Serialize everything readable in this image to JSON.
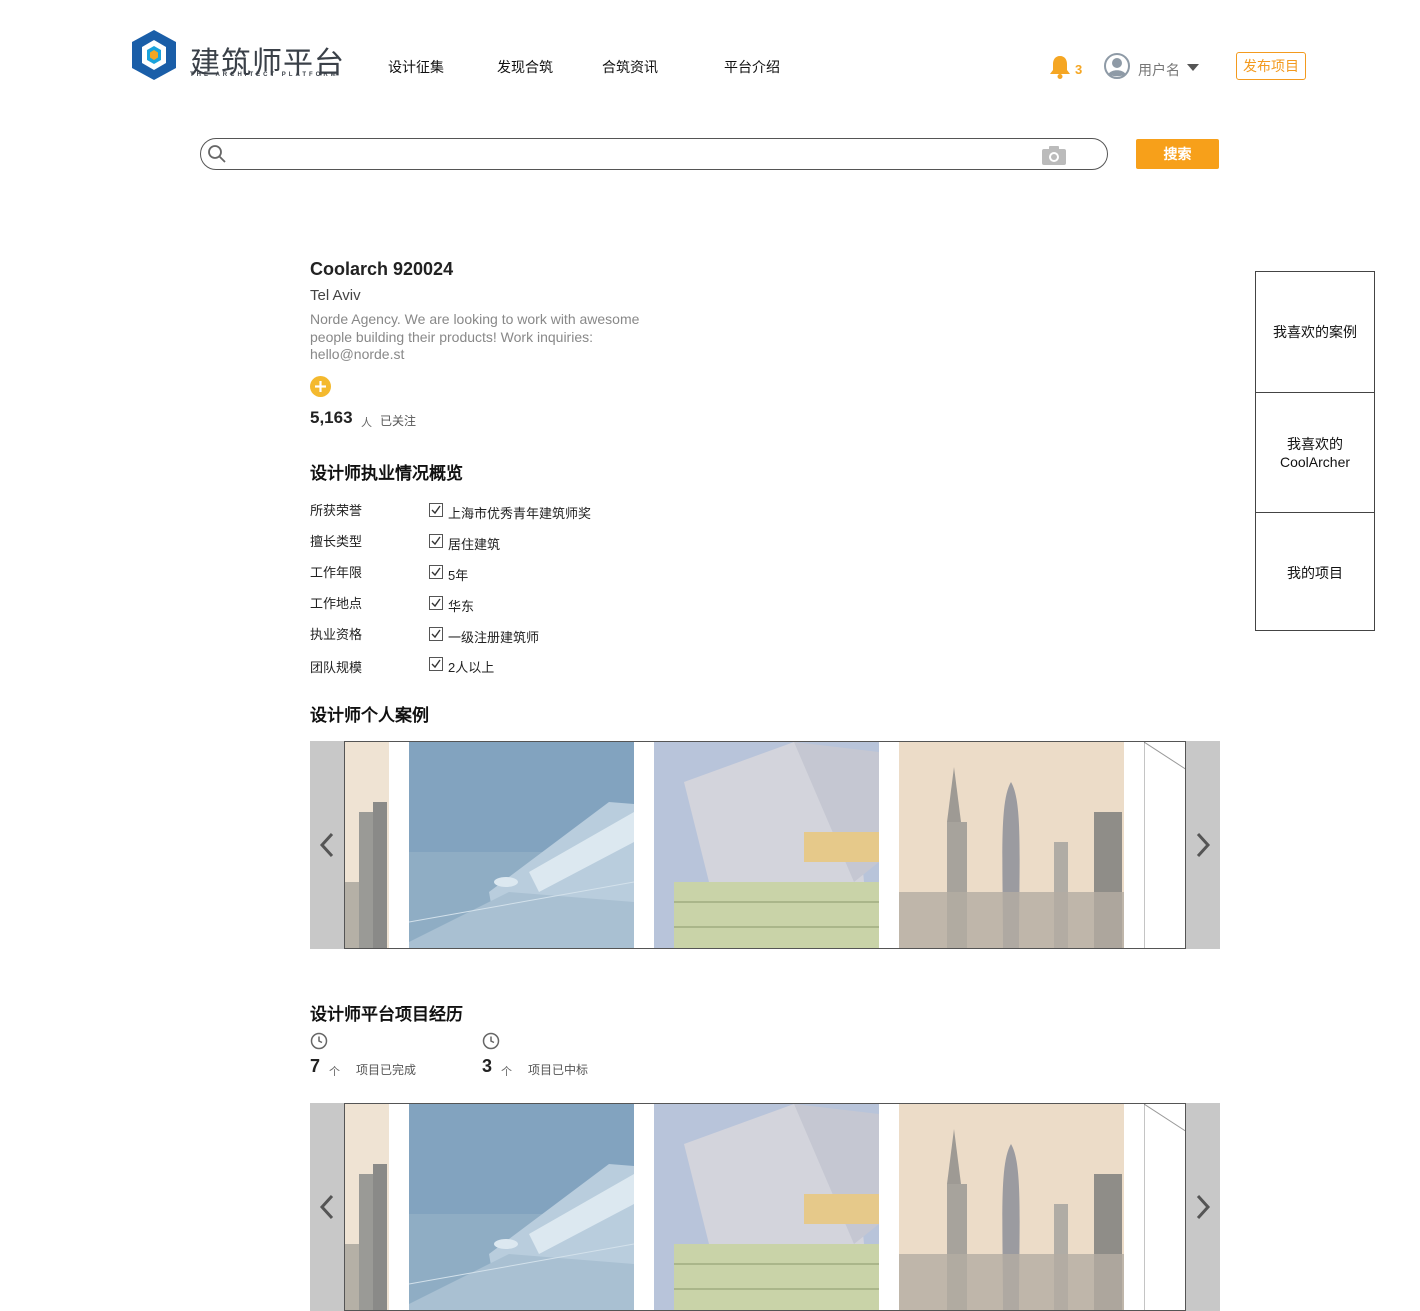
{
  "header": {
    "logo_title": "建筑师平台",
    "logo_subtitle": "THE ARCHITECT PLATFORM",
    "nav": [
      "设计征集",
      "发现合筑",
      "合筑资讯",
      "平台介绍"
    ],
    "notification_count": "3",
    "username": "用户名",
    "publish_label": "发布项目"
  },
  "search": {
    "placeholder": "",
    "button_label": "搜索"
  },
  "side_panel": {
    "items": [
      "我喜欢的案例",
      "我喜欢的CoolArcher",
      "我的项目"
    ]
  },
  "profile": {
    "name": "Coolarch 920024",
    "city": "Tel Aviv",
    "bio": "Norde Agency. We are looking to work with awesome people building their products! Work inquiries: hello@norde.st",
    "followers": "5,163",
    "followers_unit": "人",
    "followed_label": "已关注"
  },
  "overview": {
    "title": "设计师执业情况概览",
    "rows": [
      {
        "label": "所获荣誉",
        "value": "上海市优秀青年建筑师奖"
      },
      {
        "label": "擅长类型",
        "value": "居住建筑"
      },
      {
        "label": "工作年限",
        "value": "5年"
      },
      {
        "label": "工作地点",
        "value": "华东"
      },
      {
        "label": "执业资格",
        "value": "一级注册建筑师"
      },
      {
        "label": "团队规模",
        "value": "2人以上"
      }
    ]
  },
  "cases": {
    "title": "设计师个人案例"
  },
  "experience": {
    "title": "设计师平台项目经历",
    "stats": [
      {
        "value": "7",
        "unit": "个",
        "label": "项目已完成"
      },
      {
        "value": "3",
        "unit": "个",
        "label": "项目已中标"
      }
    ]
  },
  "colors": {
    "accent": "#f7a01a",
    "accent_outline": "#f39a1e",
    "follow": "#f4b92e",
    "carousel_bg": "#c8c8c8"
  },
  "icons": {
    "bell": "bell-icon",
    "avatar": "user-avatar-icon",
    "search": "search-icon",
    "camera": "camera-icon",
    "follow": "plus-icon",
    "check": "checkbox-checked-icon",
    "clock": "clock-icon",
    "prev": "chevron-left-icon",
    "next": "chevron-right-icon"
  }
}
